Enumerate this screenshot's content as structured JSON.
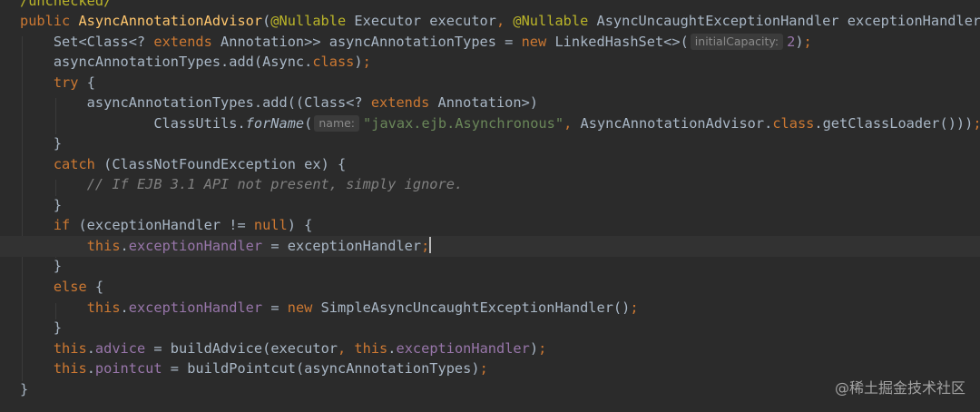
{
  "colors": {
    "background": "#2b2b2b",
    "current_line": "#323232",
    "default_text": "#a9b7c6",
    "keyword": "#cc7832",
    "annotation": "#bbb529",
    "string": "#6a8759",
    "field": "#9876aa",
    "method_declaration": "#ffc66d",
    "comment": "#808080",
    "inlay_hint_background": "#3b3b3b",
    "inlay_hint_text": "#8a8a8a"
  },
  "code": {
    "l0": {
      "t0": "/unchecked/"
    },
    "l1": {
      "t0": "public ",
      "t1": "AsyncAnnotationAdvisor",
      "t2": "(",
      "t3": "@Nullable",
      "t4": " Executor executor",
      "t5": ", ",
      "t6": "@Nullable",
      "t7": " AsyncUncaughtExceptionHandler exceptionHandler) {"
    },
    "l2": {
      "t0": "    Set<Class<? ",
      "t1": "extends",
      "t2": " Annotation>> asyncAnnotationTypes = ",
      "t3": "new",
      "t4": " LinkedHashSet<>(",
      "hint": "initialCapacity:",
      "t5": "2",
      "t6": ")",
      "t7": ";"
    },
    "l3": {
      "t0": "    asyncAnnotationTypes.add(Async.",
      "t1": "class",
      "t2": ")",
      "t3": ";"
    },
    "l4": {
      "t0": "    ",
      "t1": "try",
      "t2": " {"
    },
    "l5": {
      "t0": "        asyncAnnotationTypes.add((Class<? ",
      "t1": "extends",
      "t2": " Annotation>)"
    },
    "l6": {
      "t0": "                ClassUtils.",
      "t1": "forName",
      "t2": "(",
      "hint": "name:",
      "t3": "\"javax.ejb.Asynchronous\"",
      "t4": ", ",
      "t5": "AsyncAnnotationAdvisor.",
      "t6": "class",
      "t7": ".getClassLoader()))",
      "t8": ";"
    },
    "l7": {
      "t0": "    }"
    },
    "l8": {
      "t0": "    ",
      "t1": "catch",
      "t2": " (ClassNotFoundException ex) {"
    },
    "l9": {
      "t0": "        ",
      "t1": "// If EJB 3.1 API not present, simply ignore."
    },
    "l10": {
      "t0": "    }"
    },
    "l11": {
      "t0": "    ",
      "t1": "if",
      "t2": " (exceptionHandler != ",
      "t3": "null",
      "t4": ") {"
    },
    "l12": {
      "t0": "        ",
      "t1": "this",
      "t2": ".",
      "t3": "exceptionHandler",
      "t4": " = exceptionHandler",
      "t5": ";"
    },
    "l13": {
      "t0": "    }"
    },
    "l14": {
      "t0": "    ",
      "t1": "else",
      "t2": " {"
    },
    "l15": {
      "t0": "        ",
      "t1": "this",
      "t2": ".",
      "t3": "exceptionHandler",
      "t4": " = ",
      "t5": "new",
      "t6": " SimpleAsyncUncaughtExceptionHandler()",
      "t7": ";"
    },
    "l16": {
      "t0": "    }"
    },
    "l17": {
      "t0": "    ",
      "t1": "this",
      "t2": ".",
      "t3": "advice",
      "t4": " = buildAdvice(executor",
      "t5": ", ",
      "t6": "this",
      "t7": ".",
      "t8": "exceptionHandler",
      "t9": ")",
      "t10": ";"
    },
    "l18": {
      "t0": "    ",
      "t1": "this",
      "t2": ".",
      "t3": "pointcut",
      "t4": " = buildPointcut(asyncAnnotationTypes)",
      "t5": ";"
    },
    "l19": {
      "t0": "}"
    }
  },
  "watermark": "@稀土掘金技术社区"
}
